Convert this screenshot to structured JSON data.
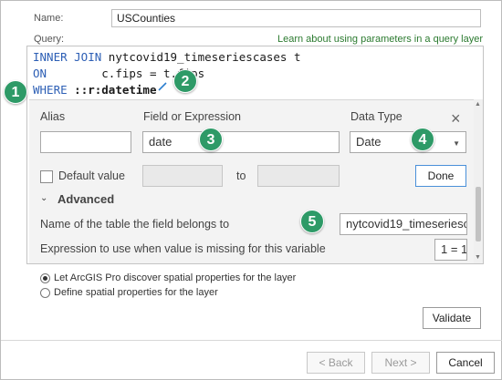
{
  "name_label": "Name:",
  "name_value": "USCounties",
  "query_label": "Query:",
  "learn_link": "Learn about using parameters in a query layer",
  "code": {
    "line1_kw": "INNER JOIN",
    "line1_rest": " nytcovid19_timeseriescases t",
    "line2_kw": "ON",
    "line2_rest": "        c.fips = t.fips",
    "line3_kw": "WHERE",
    "line3_rest": " ::r:datetime"
  },
  "param_panel": {
    "alias_label": "Alias",
    "alias_value": "",
    "field_label": "Field or Expression",
    "field_value": "date",
    "datatype_label": "Data Type",
    "datatype_value": "Date",
    "default_value_label": "Default value",
    "to_label": "to",
    "done_label": "Done",
    "advanced_label": "Advanced",
    "table_name_label": "Name of the table the field belongs to",
    "table_name_value": "nytcovid19_timeseriesc",
    "missing_expr_label": "Expression to use when value is missing for this variable",
    "missing_expr_value": "1 = 1"
  },
  "spatial": {
    "option1": "Let ArcGIS Pro discover spatial properties for the layer",
    "option2": "Define spatial properties for the layer",
    "selected": 1
  },
  "buttons": {
    "validate": "Validate",
    "back": "< Back",
    "next": "Next >",
    "cancel": "Cancel"
  },
  "callouts": [
    "1",
    "2",
    "3",
    "4",
    "5"
  ],
  "colors": {
    "callout": "#2e9a67",
    "keyword": "#2d5fb5",
    "link": "#2b7a2f"
  }
}
